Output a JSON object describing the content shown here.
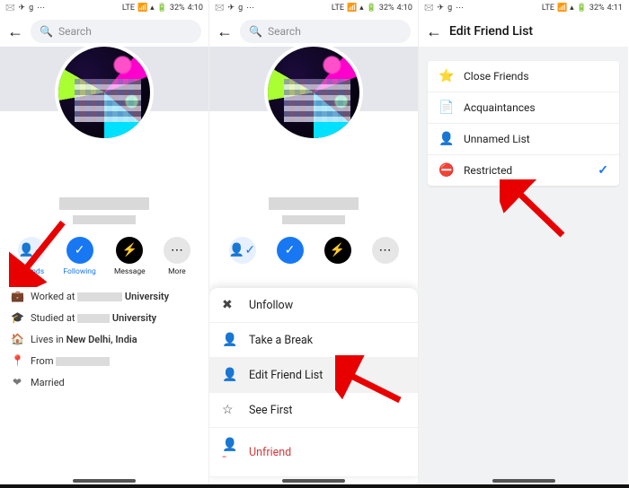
{
  "status": {
    "battery": "32%",
    "time1": "4:10",
    "time2": "4:10",
    "time3": "4:11",
    "net_label": "LTE"
  },
  "search": {
    "placeholder": "Search"
  },
  "actions": {
    "friends": "Friends",
    "following": "Following",
    "message": "Message",
    "more": "More"
  },
  "about": {
    "worked_prefix": "Worked at ",
    "worked_suffix": "University",
    "studied_prefix": "Studied at ",
    "studied_suffix": "University",
    "lives_prefix": "Lives in ",
    "lives_value": "New Delhi, India",
    "from_prefix": "From ",
    "married": "Married"
  },
  "sheet": {
    "unfollow": "Unfollow",
    "take_break": "Take a Break",
    "edit_list": "Edit Friend List",
    "see_first": "See First",
    "unfriend": "Unfriend"
  },
  "screen3": {
    "title": "Edit Friend List",
    "items": [
      {
        "label": "Close Friends",
        "icon": "⭐",
        "checked": false
      },
      {
        "label": "Acquaintances",
        "icon": "📄",
        "checked": false
      },
      {
        "label": "Unnamed List",
        "icon": "👤",
        "checked": false
      },
      {
        "label": "Restricted",
        "icon": "⛔",
        "checked": true
      }
    ]
  }
}
